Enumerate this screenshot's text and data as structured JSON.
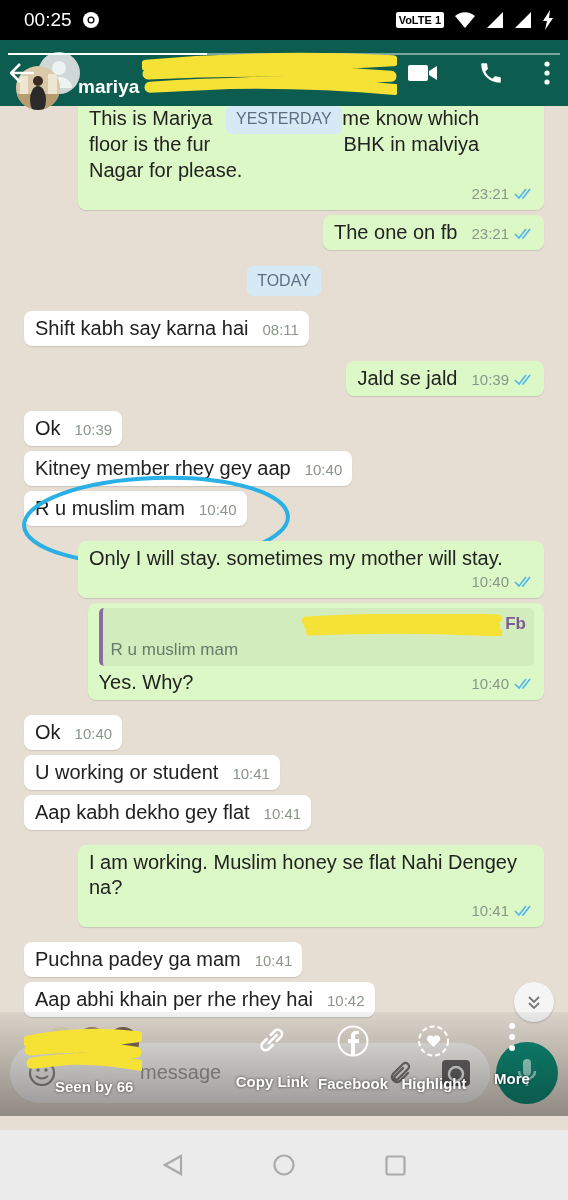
{
  "status_bar": {
    "time": "00:25",
    "network_badge": "VoLTE 1"
  },
  "story": {
    "progress": {
      "level": 0.36
    },
    "user": "mariya",
    "seen_by": {
      "label": "Seen by 66",
      "redacted": true
    },
    "actions": [
      {
        "kind": "link",
        "label": "Copy Link"
      },
      {
        "kind": "facebook",
        "label": "Facebook"
      },
      {
        "kind": "highlight",
        "label": "Highlight"
      },
      {
        "kind": "more",
        "label": "More"
      }
    ]
  },
  "header": {
    "title_redacted": true
  },
  "chat": [
    {
      "kind": "message",
      "outgoing": true,
      "lines": [
        [
          "This is Mariya",
          "me know which"
        ],
        [
          "floor is the fur",
          "BHK in malviya"
        ],
        [
          "Nagar for please."
        ]
      ],
      "time": "23:21",
      "read": true,
      "overlay_label": "YESTERDAY"
    },
    {
      "kind": "message",
      "outgoing": true,
      "text": "The one on fb",
      "time": "23:21",
      "read": true
    },
    {
      "kind": "date",
      "label": "TODAY"
    },
    {
      "kind": "message",
      "outgoing": false,
      "text": "Shift kabh say karna hai",
      "time": "08:11"
    },
    {
      "kind": "message",
      "outgoing": true,
      "text": "Jald se jald",
      "time": "10:39",
      "read": true
    },
    {
      "kind": "message",
      "outgoing": false,
      "text": "Ok",
      "time": "10:39"
    },
    {
      "kind": "message",
      "outgoing": false,
      "text": "Kitney member rhey gey aap",
      "time": "10:40"
    },
    {
      "kind": "message",
      "outgoing": false,
      "text": "R u muslim mam",
      "time": "10:40",
      "circled": true
    },
    {
      "kind": "message",
      "outgoing": true,
      "text": "Only I will stay. sometimes my mother will stay.",
      "time": "10:40",
      "read": true
    },
    {
      "kind": "message",
      "outgoing": true,
      "quote": {
        "author_end": "Fb",
        "author_redacted": true,
        "text": "R u muslim mam"
      },
      "text": "Yes. Why?",
      "time": "10:40",
      "read": true
    },
    {
      "kind": "message",
      "outgoing": false,
      "text": "Ok",
      "time": "10:40"
    },
    {
      "kind": "message",
      "outgoing": false,
      "text": "U working or student",
      "time": "10:41"
    },
    {
      "kind": "message",
      "outgoing": false,
      "text": "Aap kabh dekho gey flat",
      "time": "10:41"
    },
    {
      "kind": "message",
      "outgoing": true,
      "text": "I am working. Muslim honey se flat Nahi Dengey na?",
      "time": "10:41",
      "read": true
    },
    {
      "kind": "message",
      "outgoing": false,
      "text": "Puchna padey ga mam",
      "time": "10:41"
    },
    {
      "kind": "message",
      "outgoing": false,
      "text": "Aap abhi khain per rhe rhey hai",
      "time": "10:42"
    }
  ],
  "composer": {
    "placeholder": "message"
  }
}
